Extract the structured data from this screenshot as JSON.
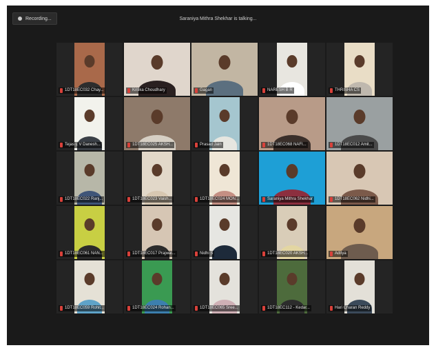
{
  "recording_label": "Recording...",
  "talking_indicator": "Saraniya Mithra Shekhar is talking...",
  "colors": {
    "screen_bg": "#1a1a1a",
    "muted_mic": "#d9413a"
  },
  "participants": [
    {
      "name": "1DT18EC032 Chay...",
      "bg": "#a9694a",
      "shirt": "#2d2d2d",
      "wide": false
    },
    {
      "name": "Kritika Choudhary",
      "bg": "#e0d6cc",
      "shirt": "#2a2020",
      "wide": true
    },
    {
      "name": "Gagan",
      "bg": "#c2b6a3",
      "shirt": "#5b6f7f",
      "wide": true
    },
    {
      "name": "NARESH B R",
      "bg": "#e8e6e0",
      "shirt": "#ffffff",
      "wide": false
    },
    {
      "name": "THRISHA CS",
      "bg": "#e9ddc6",
      "shirt": "#bfb8ae",
      "wide": false
    },
    {
      "name": "Tejas L V Danesh...",
      "bg": "#f2f2ec",
      "shirt": "#3a3f46",
      "wide": false
    },
    {
      "name": "1DT18EC025 AKSH...",
      "bg": "#8e7a6a",
      "shirt": "#d6cfc4",
      "wide": true
    },
    {
      "name": "Prasad Jain",
      "bg": "#a5c6cf",
      "shirt": "#e6e6e0",
      "wide": false
    },
    {
      "name": "1DT18EC068 NAFI...",
      "bg": "#b89b88",
      "shirt": "#3a2f2a",
      "wide": true
    },
    {
      "name": "1DT18EC012 Amit...",
      "bg": "#9aa0a1",
      "shirt": "#4a4a4a",
      "wide": true
    },
    {
      "name": "1DT18EC022 Ranj...",
      "bg": "#b7b7a8",
      "shirt": "#3f5578",
      "wide": false
    },
    {
      "name": "1DT18EC023 Vaish...",
      "bg": "#e2d8c9",
      "shirt": "#d7c7b1",
      "wide": false
    },
    {
      "name": "1DT18EC024 MON...",
      "bg": "#efe6d6",
      "shirt": "#c48f83",
      "wide": false
    },
    {
      "name": "Saraniya Mithra Shekhar",
      "bg": "#1e9fd6",
      "shirt": "#8c2f3f",
      "wide": true
    },
    {
      "name": "1DT18EC062 Nidhi...",
      "bg": "#d8c7b4",
      "shirt": "#7b5a4a",
      "wide": true
    },
    {
      "name": "1DT18EC061 NAN...",
      "bg": "#c8cf43",
      "shirt": "#2a2a2a",
      "wide": false
    },
    {
      "name": "1DT18EC017 Prajwal...",
      "bg": "#d6c6b4",
      "shirt": "#2b2b2b",
      "wide": false
    },
    {
      "name": "Nidhi S",
      "bg": "#e6e6e2",
      "shirt": "#1d2a3a",
      "wide": false
    },
    {
      "name": "1DT18EC020 AKSH...",
      "bg": "#d9cdb8",
      "shirt": "#e3d6a2",
      "wide": false
    },
    {
      "name": "Aditya",
      "bg": "#c8a77e",
      "shirt": "#6e5c4e",
      "wide": true
    },
    {
      "name": "1DT18EC059 Rohit...",
      "bg": "#e5e1d6",
      "shirt": "#5fa3c8",
      "wide": false
    },
    {
      "name": "1DT18EC024 Rohan...",
      "bg": "#3a9a52",
      "shirt": "#3c7fae",
      "wide": false
    },
    {
      "name": "1DT18EC065 Sree...",
      "bg": "#e4e2dc",
      "shirt": "#cfb0b5",
      "wide": false
    },
    {
      "name": "1DT18EC112 - Kedar...",
      "bg": "#4d6b3c",
      "shirt": "#2c2c2c",
      "wide": false
    },
    {
      "name": "Hari Charan Reddy",
      "bg": "#e3e0d8",
      "shirt": "#3b4a5a",
      "wide": false
    }
  ]
}
